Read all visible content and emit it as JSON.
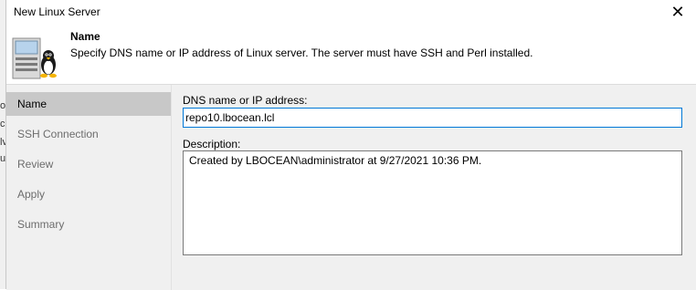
{
  "background_window": {
    "fragments": [
      "o",
      "c",
      "lv",
      "u"
    ]
  },
  "dialog": {
    "title": "New Linux Server",
    "close_glyph": "✕"
  },
  "header": {
    "icon": "linux-server-icon",
    "title": "Name",
    "description": "Specify DNS name or IP address of Linux server. The server must have SSH and Perl installed."
  },
  "nav": {
    "items": [
      {
        "label": "Name",
        "active": true
      },
      {
        "label": "SSH Connection",
        "active": false
      },
      {
        "label": "Review",
        "active": false
      },
      {
        "label": "Apply",
        "active": false
      },
      {
        "label": "Summary",
        "active": false
      }
    ]
  },
  "form": {
    "dns_label": "DNS name or IP address:",
    "dns_value": "repo10.lbocean.lcl",
    "description_label": "Description:",
    "description_value": "Created by LBOCEAN\\administrator at 9/27/2021 10:36 PM."
  },
  "colors": {
    "accent": "#0078d7",
    "nav_active_bg": "#c8c8c8",
    "panel_bg": "#f0f0f0"
  }
}
